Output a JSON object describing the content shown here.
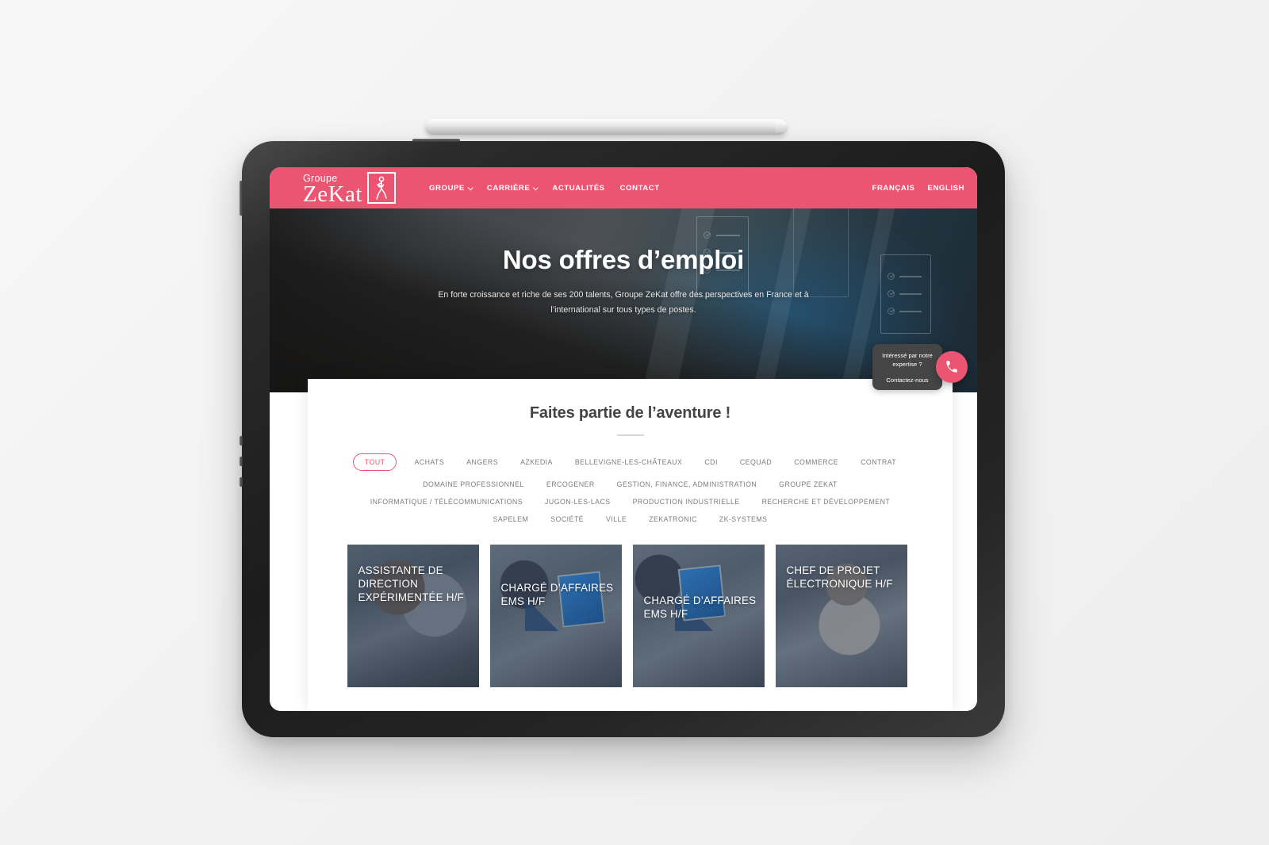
{
  "brand": {
    "logo_top": "Groupe",
    "logo_main": "ZeKat",
    "logo_mark_name": "zekat-figure-mark",
    "accent_color": "#ec5571",
    "dark_color": "#454545"
  },
  "nav": {
    "items": [
      {
        "label": "GROUPE",
        "has_caret": true
      },
      {
        "label": "CARRIÈRE",
        "has_caret": true
      },
      {
        "label": "ACTUALITÉS",
        "has_caret": false
      },
      {
        "label": "CONTACT",
        "has_caret": false
      }
    ],
    "languages": [
      {
        "label": "FRANÇAIS"
      },
      {
        "label": "ENGLISH"
      }
    ]
  },
  "hero": {
    "title": "Nos offres d’emploi",
    "subtitle": "En forte croissance et riche de ses 200 talents, Groupe ZeKat offre des perspectives en France et à l’international sur tous types de postes."
  },
  "panel": {
    "section_title": "Faites partie de l’aventure !",
    "filters": [
      {
        "label": "TOUT",
        "active": true
      },
      {
        "label": "ACHATS",
        "active": false
      },
      {
        "label": "ANGERS",
        "active": false
      },
      {
        "label": "AZKEDIA",
        "active": false
      },
      {
        "label": "BELLEVIGNE-LES-CHÂTEAUX",
        "active": false
      },
      {
        "label": "CDI",
        "active": false
      },
      {
        "label": "CEQUAD",
        "active": false
      },
      {
        "label": "COMMERCE",
        "active": false
      },
      {
        "label": "CONTRAT",
        "active": false
      },
      {
        "label": "DOMAINE PROFESSIONNEL",
        "active": false
      },
      {
        "label": "ERCOGENER",
        "active": false
      },
      {
        "label": "GESTION, FINANCE, ADMINISTRATION",
        "active": false
      },
      {
        "label": "GROUPE ZEKAT",
        "active": false
      },
      {
        "label": "INFORMATIQUE / TÉLÉCOMMUNICATIONS",
        "active": false
      },
      {
        "label": "JUGON-LES-LACS",
        "active": false
      },
      {
        "label": "PRODUCTION INDUSTRIELLE",
        "active": false
      },
      {
        "label": "RECHERCHE ET DÉVELOPPEMENT",
        "active": false
      },
      {
        "label": "SAPELEM",
        "active": false
      },
      {
        "label": "SOCIÉTÉ",
        "active": false
      },
      {
        "label": "VILLE",
        "active": false
      },
      {
        "label": "ZEKATRONIC",
        "active": false
      },
      {
        "label": "ZK-SYSTEMS",
        "active": false
      }
    ],
    "jobs": [
      {
        "title": "ASSISTANTE DE DIRECTION EXPÉRIMENTÉE H/F"
      },
      {
        "title": "CHARGÉ D’AFFAIRES EMS H/F"
      },
      {
        "title": "CHARGÉ D’AFFAIRES EMS H/F"
      },
      {
        "title": "CHEF DE PROJET ÉLECTRONIQUE H/F"
      }
    ]
  },
  "contact_widget": {
    "line1": "Intéressé par notre expertise ?",
    "line2": "Contactez-nous",
    "icon": "phone-icon"
  }
}
